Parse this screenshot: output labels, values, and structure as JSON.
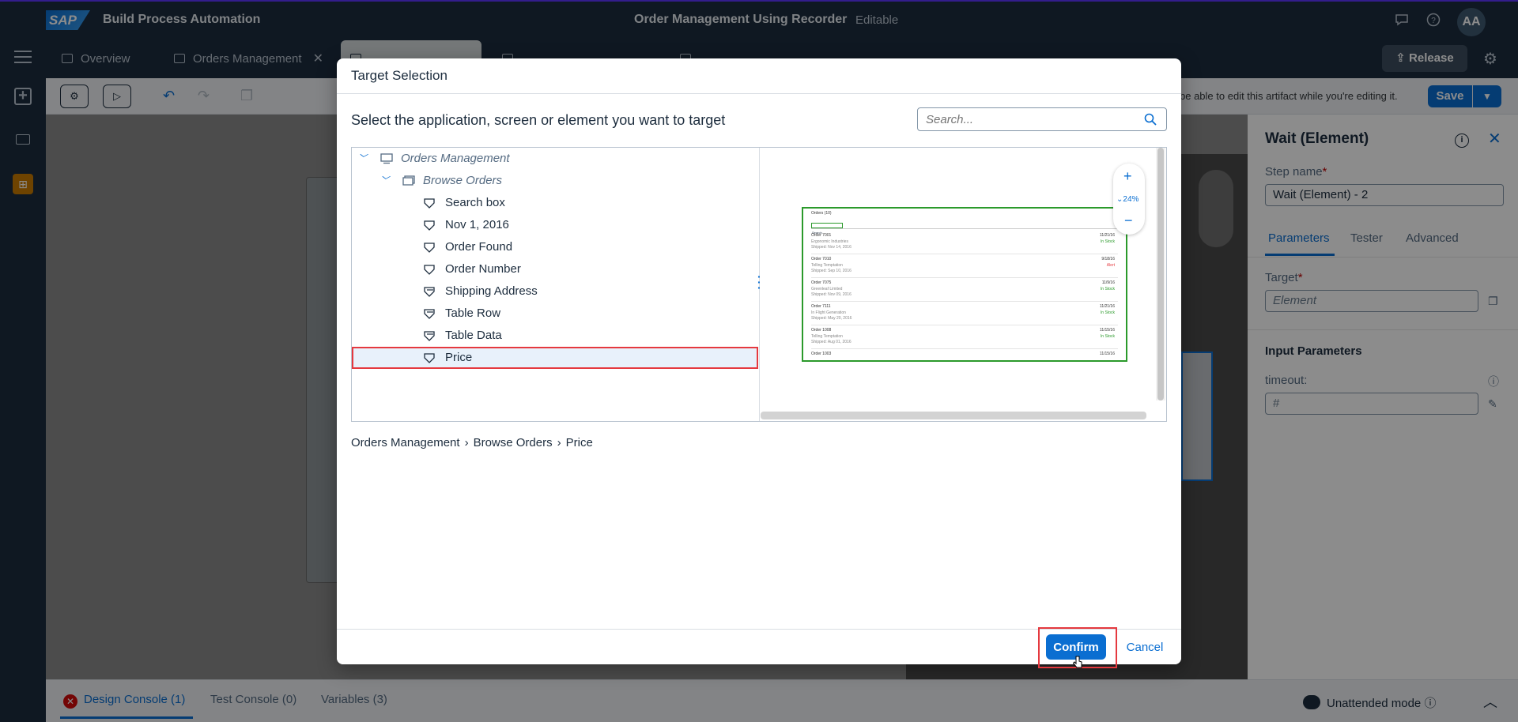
{
  "shell": {
    "product_name": "Build Process Automation",
    "logo_text": "SAP",
    "title": "Order Management Using Recorder",
    "state": "Editable",
    "avatar_initials": "AA"
  },
  "tabs": [
    {
      "label": "Overview",
      "icon": "clipboard-icon",
      "closable": false
    },
    {
      "label": "Orders Management",
      "icon": "screen-icon",
      "closable": true
    },
    {
      "label": "",
      "icon": "screen-icon",
      "closable": true,
      "active": true
    },
    {
      "label": "",
      "icon": "screen-icon",
      "closable": true
    },
    {
      "label": "",
      "icon": "screen-icon",
      "closable": true
    }
  ],
  "release_label": "Release",
  "toolbar": {
    "notice": "be able to edit this artifact while you're editing it.",
    "save_label": "Save"
  },
  "right_panel": {
    "title": "Wait (Element)",
    "step_name_label": "Step name",
    "step_name_value": "Wait (Element) - 2",
    "tabs": [
      "Parameters",
      "Tester",
      "Advanced"
    ],
    "active_tab": "Parameters",
    "target_label": "Target",
    "target_placeholder": "Element",
    "section_title": "Input Parameters",
    "timeout_label": "timeout:",
    "timeout_placeholder": "#"
  },
  "bottom_bar": {
    "design_console": "Design Console (1)",
    "test_console": "Test Console (0)",
    "variables": "Variables (3)",
    "mode": "Unattended mode"
  },
  "dialog": {
    "title": "Target Selection",
    "instruction": "Select the application, screen or element you want to target",
    "search_placeholder": "Search...",
    "tree": {
      "application": "Orders Management",
      "screen": "Browse Orders",
      "elements": [
        "Search box",
        "Nov 1, 2016",
        "Order Found",
        "Order Number",
        "Shipping Address",
        "Table Row",
        "Table Data",
        "Price"
      ],
      "selected": "Price"
    },
    "preview": {
      "zoom_label": "24%",
      "header": "Orders (10)",
      "search_text": "Search",
      "rows": [
        {
          "title": "Order 7001",
          "sub": "Ergonomic Industries",
          "line": "Shipped: Nov 14, 2016",
          "date": "11/21/16",
          "status": "In Stock"
        },
        {
          "title": "Order 7010",
          "sub": "Telling Temptation",
          "line": "Shipped: Sep 10, 2016",
          "date": "9/18/16",
          "status": "Alert"
        },
        {
          "title": "Order 7075",
          "sub": "Greenleaf Limited",
          "line": "Shipped: Nov 09, 2016",
          "date": "11/9/16",
          "status": "In Stock"
        },
        {
          "title": "Order 7111",
          "sub": "In Flight Generation",
          "line": "Shipped: May 20, 2016",
          "date": "11/21/16",
          "status": "In Stock"
        },
        {
          "title": "Order 1008",
          "sub": "Telling Temptation",
          "line": "Shipped: Aug 01, 2016",
          "date": "11/15/16",
          "status": "In Stock"
        },
        {
          "title": "Order 1003",
          "sub": "",
          "line": "",
          "date": "11/15/16",
          "status": ""
        }
      ]
    },
    "breadcrumb": [
      "Orders Management",
      "Browse Orders",
      "Price"
    ],
    "confirm_label": "Confirm",
    "cancel_label": "Cancel"
  },
  "colors": {
    "shell_bg": "#1d2d3e",
    "brand_blue": "#0a6ed1",
    "highlight_red": "#e5393f",
    "target_green": "#2b9a2b",
    "error_red": "#d20a0a"
  }
}
